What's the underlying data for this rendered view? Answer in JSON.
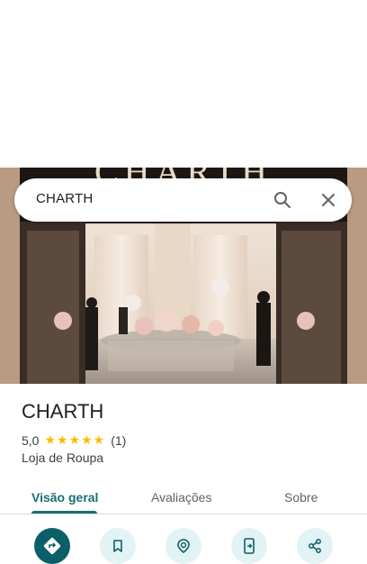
{
  "search": {
    "query": "CHARTH"
  },
  "hero": {
    "storefront_sign": "CHARTH"
  },
  "place": {
    "name": "CHARTH",
    "rating": "5,0",
    "stars": "★★★★★",
    "review_count": "(1)",
    "category": "Loja de Roupa"
  },
  "tabs": [
    {
      "label": "Visão geral",
      "active": true
    },
    {
      "label": "Avaliações",
      "active": false
    },
    {
      "label": "Sobre",
      "active": false
    }
  ],
  "actions": [
    {
      "icon": "directions-icon"
    },
    {
      "icon": "bookmark-icon"
    },
    {
      "icon": "nearby-icon"
    },
    {
      "icon": "send-to-phone-icon"
    },
    {
      "icon": "share-icon"
    }
  ],
  "colors": {
    "accent": "#1a6e74",
    "primary_action": "#0b5f66",
    "action_bg": "#e2f3f5",
    "star": "#fbbc04"
  }
}
